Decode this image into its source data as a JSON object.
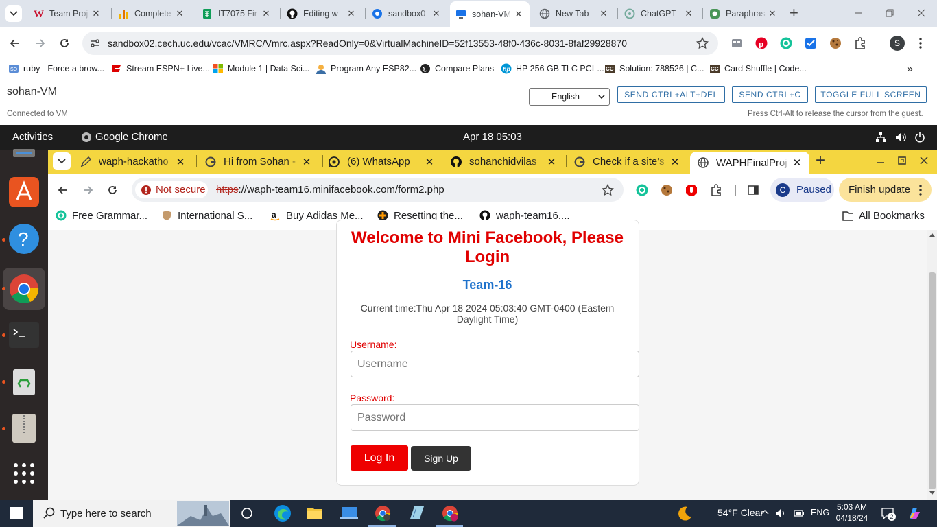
{
  "outer_browser": {
    "tabs": [
      {
        "label": "Team Proj",
        "icon": "uc-icon",
        "color": "#c8102e"
      },
      {
        "label": "Complete",
        "icon": "chart-icon",
        "color": "#f4b400"
      },
      {
        "label": "IT7075 Fir",
        "icon": "sheets-icon",
        "color": "#0f9d58"
      },
      {
        "label": "Editing w",
        "icon": "github-icon",
        "color": "#000000"
      },
      {
        "label": "sandbox0",
        "icon": "globe-icon",
        "color": "#1a73e8"
      },
      {
        "label": "sohan-VM",
        "icon": "monitor-icon",
        "color": "#1a73e8"
      },
      {
        "label": "New Tab",
        "icon": "globe-icon",
        "color": "#5f6368"
      },
      {
        "label": "ChatGPT",
        "icon": "chatgpt-icon",
        "color": "#74aa9c"
      },
      {
        "label": "Paraphras",
        "icon": "quillbot-icon",
        "color": "#499557"
      }
    ],
    "url": "sandbox02.cech.uc.edu/vcac/VMRC/Vmrc.aspx?ReadOnly=0&VirtualMachineID=52f13553-48f0-436c-8031-8faf29928870",
    "bookmarks": [
      "ruby - Force a brow...",
      "Stream ESPN+ Live...",
      "Module 1 | Data Sci...",
      "Program Any ESP82...",
      "Compare Plans",
      "HP 256 GB TLC PCI-...",
      "Solution: 788526 | C...",
      "Card Shuffle | Code..."
    ],
    "profile_initial": "S"
  },
  "vmrc": {
    "vm_name": "sohan-VM",
    "status": "Connected to VM",
    "language": "English",
    "buttons": [
      "SEND CTRL+ALT+DEL",
      "SEND CTRL+C",
      "TOGGLE FULL SCREEN"
    ],
    "hint": "Press Ctrl-Alt to release the cursor from the guest."
  },
  "ubuntu": {
    "activities": "Activities",
    "app": "Google Chrome",
    "clock": "Apr 18  05:03"
  },
  "inner_browser": {
    "tabs": [
      {
        "label": "waph-hackatho",
        "icon": "pencil-icon"
      },
      {
        "label": "Hi from Sohan -",
        "icon": "google-icon"
      },
      {
        "label": "(6) WhatsApp",
        "icon": "whatsapp-icon"
      },
      {
        "label": "sohanchidvilas",
        "icon": "github-icon"
      },
      {
        "label": "Check if a site's",
        "icon": "google-icon"
      },
      {
        "label": "WAPHFinalProj",
        "icon": "globe-icon"
      }
    ],
    "security": "Not secure",
    "url_proto": "https",
    "url_rest": "://waph-team16.minifacebook.com/form2.php",
    "paused": "Paused",
    "paused_initial": "C",
    "update": "Finish update",
    "bookmarks": [
      "Free Grammar...",
      "International S...",
      "Buy Adidas Me...",
      "Resetting the...",
      "waph-team16...."
    ],
    "all_bookmarks": "All Bookmarks"
  },
  "page": {
    "welcome": "Welcome to Mini Facebook, Please Login",
    "team": "Team-16",
    "current_time": "Current time:Thu Apr 18 2024 05:03:40 GMT-0400 (Eastern Daylight Time)",
    "username_label": "Username:",
    "username_placeholder": "Username",
    "password_label": "Password:",
    "password_placeholder": "Password",
    "login": "Log In",
    "signup": "Sign Up"
  },
  "taskbar": {
    "search_placeholder": "Type here to search",
    "weather": "54°F  Clear",
    "lang": "ENG",
    "time": "5:03 AM",
    "date": "04/18/24",
    "notifications": "2"
  },
  "colors": {
    "accent_red": "#e00000",
    "team_blue": "#1e72cc",
    "inner_tabstrip": "#f4d640",
    "ubuntu_bar": "#1d1d1d",
    "dock": "#2c2727"
  }
}
